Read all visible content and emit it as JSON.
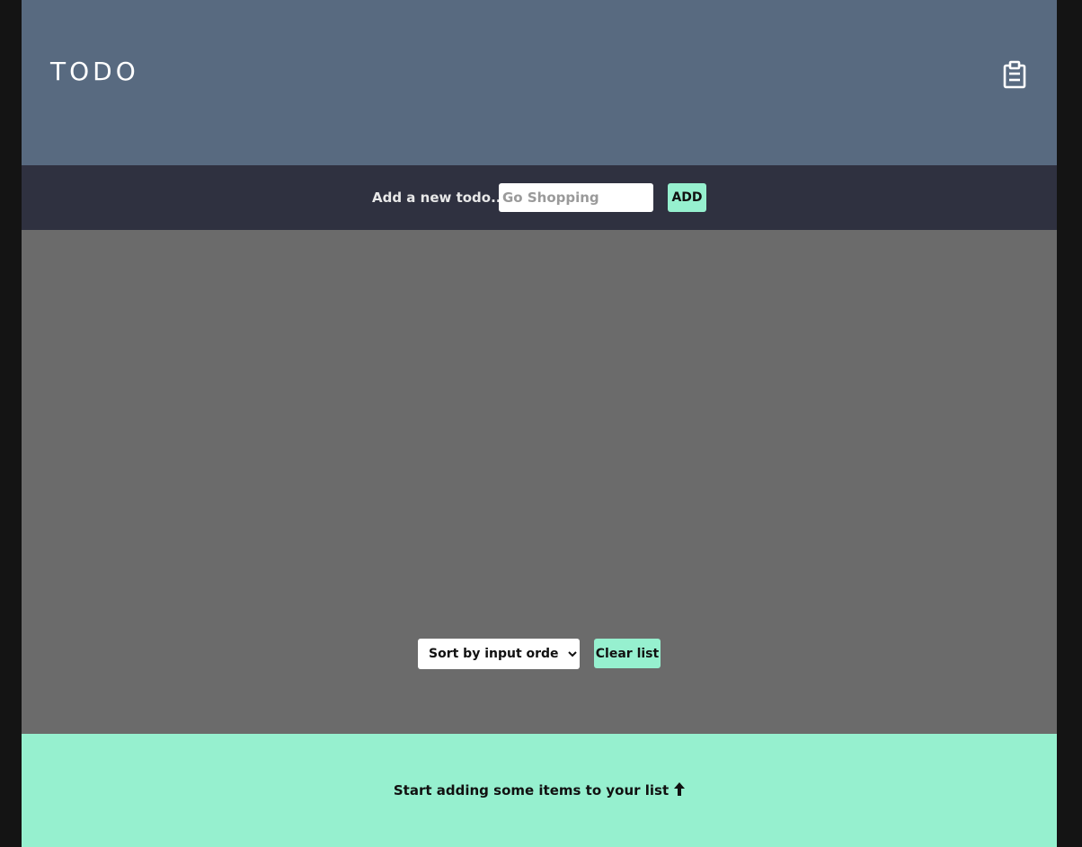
{
  "header": {
    "title": "TODO",
    "icon": "clipboard-icon"
  },
  "add_bar": {
    "label": "Add a new todo...",
    "input_value": "",
    "input_placeholder": "Go Shopping",
    "add_label": "ADD"
  },
  "controls": {
    "sort_selected": "Sort by input order",
    "sort_options": [
      "Sort by input order"
    ],
    "clear_label": "Clear list"
  },
  "footer": {
    "message": "Start adding some items to your list",
    "icon": "arrow-up-icon"
  },
  "colors": {
    "header_bg": "#586a80",
    "addbar_bg": "#2f3140",
    "main_bg": "#6b6b6b",
    "accent": "#96f0cf",
    "page_bg": "#141414"
  }
}
